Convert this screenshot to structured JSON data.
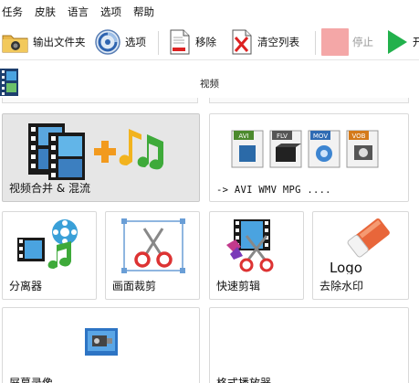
{
  "menu": {
    "items": [
      "任务",
      "皮肤",
      "语言",
      "选项",
      "帮助"
    ]
  },
  "toolbar": {
    "output_folder": "输出文件夹",
    "options": "选项",
    "remove": "移除",
    "clear_list": "清空列表",
    "stop": "停止",
    "start": "开"
  },
  "category": {
    "title": "视频"
  },
  "tiles": {
    "video_join_mix": "视频合并 & 混流",
    "to_formats": "-> AVI WMV MPG ....",
    "splitter": "分离器",
    "crop": "画面裁剪",
    "quick_cut": "快速剪辑",
    "remove_watermark": "去除水印",
    "screen_record": "屏幕录像",
    "format_player": "格式播放器"
  },
  "format_badges": [
    "AVI",
    "FLV",
    "MOV",
    "VOB"
  ],
  "logo_text": "Logo",
  "colors": {
    "accent_green": "#22b14c",
    "stop_pink": "#f4a7a7",
    "selected_tile": "#e6e6e6",
    "tile_border": "#d9d9d9"
  }
}
